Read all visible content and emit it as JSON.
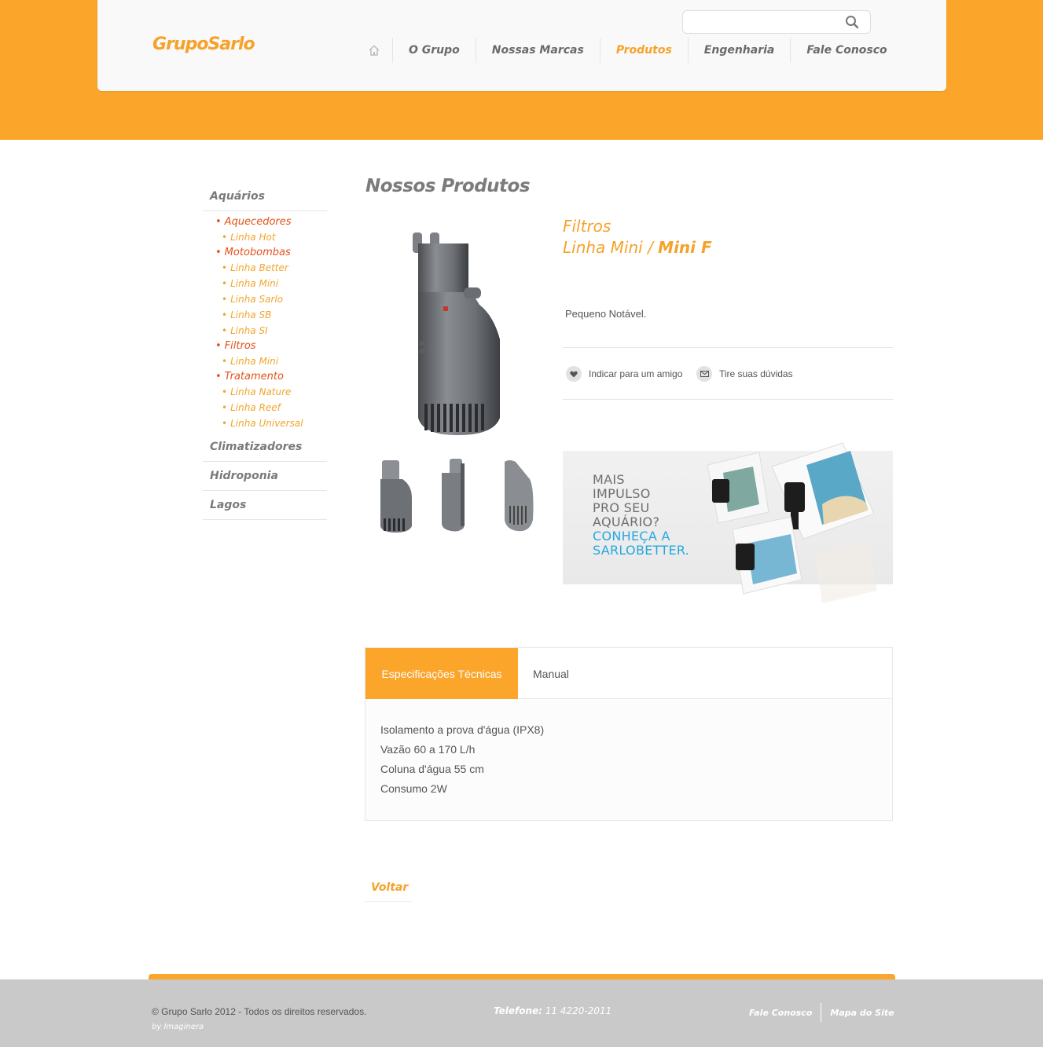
{
  "header": {
    "logo_text": "GrupoSarlo",
    "search_placeholder": "",
    "nav": [
      {
        "label": "O Grupo"
      },
      {
        "label": "Nossas Marcas"
      },
      {
        "label": "Produtos",
        "active": true
      },
      {
        "label": "Engenharia"
      },
      {
        "label": "Fale Conosco"
      }
    ]
  },
  "sidebar": {
    "categories": [
      {
        "label": "Aquários"
      },
      {
        "label": "Climatizadores"
      },
      {
        "label": "Hidroponia"
      },
      {
        "label": "Lagos"
      }
    ],
    "aquarios": [
      {
        "label": "Aquecedores",
        "items": [
          "Linha Hot"
        ]
      },
      {
        "label": "Motobombas",
        "items": [
          "Linha Better",
          "Linha Mini",
          "Linha Sarlo",
          "Linha SB",
          "Linha SI"
        ]
      },
      {
        "label": "Filtros",
        "items": [
          "Linha Mini"
        ]
      },
      {
        "label": "Tratamento",
        "items": [
          "Linha Nature",
          "Linha Reef",
          "Linha Universal"
        ]
      }
    ]
  },
  "main": {
    "page_title": "Nossos Produtos",
    "product": {
      "category": "Filtros",
      "line_prefix": "Linha Mini / ",
      "line_model": "Mini F",
      "description": "Pequeno Notável.",
      "actions": [
        {
          "label": "Indicar para um amigo",
          "icon": "heart-icon"
        },
        {
          "label": "Tire suas dúvidas",
          "icon": "envelope-icon"
        }
      ]
    },
    "banner": {
      "line1": "MAIS",
      "line2": "IMPULSO",
      "line3": "PRO SEU",
      "line4": "AQUÁRIO?",
      "line5": "CONHEÇA A",
      "line6": "SARLOBETTER.",
      "highlight_color": "#25a8dd"
    },
    "tabs": [
      {
        "label": "Especificações Técnicas",
        "active": true
      },
      {
        "label": "Manual",
        "active": false
      }
    ],
    "specs": [
      "Isolamento a prova d'água (IPX8)",
      "Vazão 60 a 170 L/h",
      "Coluna d'água 55 cm",
      "Consumo 2W"
    ],
    "back_label": "Voltar"
  },
  "footer": {
    "copyright": "© Grupo Sarlo 2012 - Todos os direitos reservados.",
    "byline": "by Imaginera",
    "phone_label": "Telefone:",
    "phone_number": " 11 4220-2011",
    "links": [
      "Fale Conosco",
      "Mapa do Site"
    ]
  },
  "colors": {
    "brand_orange": "#fba52a",
    "accent_red": "#e5511a",
    "footer_gray": "#c9c9c9"
  }
}
